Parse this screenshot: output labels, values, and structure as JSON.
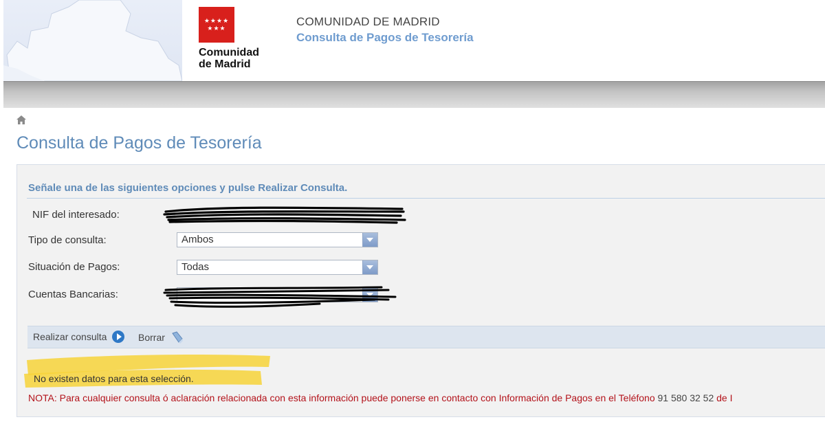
{
  "header": {
    "logo_stars": "★★★★\n★★★",
    "logo_name_line1": "Comunidad",
    "logo_name_line2": "de Madrid",
    "org_title": "COMUNIDAD DE MADRID",
    "app_title": "Consulta de Pagos de Tesorería"
  },
  "page": {
    "title": "Consulta de Pagos de Tesorería"
  },
  "form": {
    "heading": "Señale una de las siguientes opciones y pulse Realizar Consulta.",
    "nif_label": "NIF del interesado:",
    "tipo_label": "Tipo de consulta:",
    "tipo_value": "Ambos",
    "situacion_label": "Situación de Pagos:",
    "situacion_value": "Todas",
    "cuentas_label": "Cuentas Bancarias:"
  },
  "actions": {
    "submit_label": "Realizar consulta",
    "clear_label": "Borrar"
  },
  "messages": {
    "no_data": "No existen datos para esta selección.",
    "note_text": "NOTA: Para cualquier consulta ó aclaración relacionada con esta información puede ponerse en contacto con Información de Pagos en el Teléfono ",
    "note_phone": "91 580 32 52",
    "note_tail": " de I"
  },
  "colors": {
    "accent_blue": "#5f8bb8",
    "note_red": "#b3121a",
    "highlight_yellow": "#f7d43a"
  }
}
